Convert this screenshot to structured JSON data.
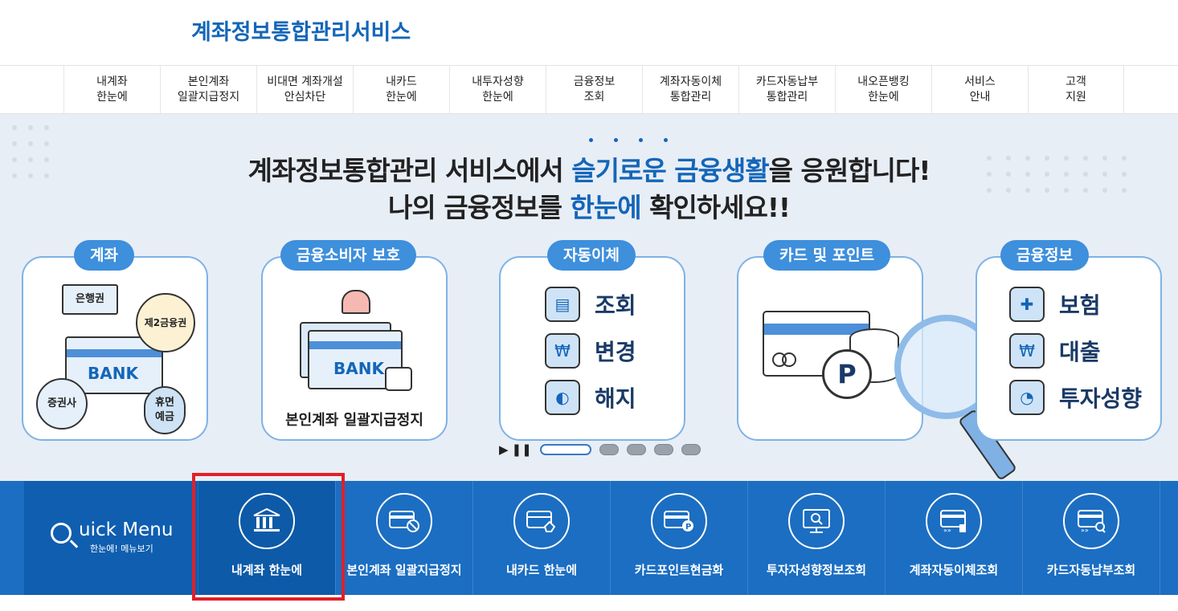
{
  "header": {
    "logo": "계좌정보통합관리서비스"
  },
  "gnb": [
    {
      "label": "내계좌\n한눈에"
    },
    {
      "label": "본인계좌\n일괄지급정지"
    },
    {
      "label": "비대면 계좌개설\n안심차단"
    },
    {
      "label": "내카드\n한눈에"
    },
    {
      "label": "내투자성향\n한눈에"
    },
    {
      "label": "금융정보\n조회"
    },
    {
      "label": "계좌자동이체\n통합관리"
    },
    {
      "label": "카드자동납부\n통합관리"
    },
    {
      "label": "내오픈뱅킹\n한눈에"
    },
    {
      "label": "서비스\n안내"
    },
    {
      "label": "고객\n지원"
    }
  ],
  "banner": {
    "line1_pre": "계좌정보통합관리 서비스에서 ",
    "line1_hl": "슬기로운 금융생활",
    "line1_post": "을 응원합니다!",
    "line2_pre": "나의 금융정보를 ",
    "line2_hl": "한눈에",
    "line2_post": " 확인하세요!!",
    "cards": [
      {
        "tag": "계좌",
        "bubbles": [
          "은행권",
          "제2금융권",
          "증권사",
          "휴면\n예금"
        ],
        "bank": "BANK"
      },
      {
        "tag": "금융소비자 보호",
        "bank": "BANK",
        "caption": "본인계좌 일괄지급정지"
      },
      {
        "tag": "자동이체",
        "items": [
          "조회",
          "변경",
          "해지"
        ]
      },
      {
        "tag": "카드 및 포인트",
        "point": "P"
      },
      {
        "tag": "금융정보",
        "items": [
          "보험",
          "대출",
          "투자성향"
        ]
      }
    ]
  },
  "quick": {
    "title_big": "uick Menu",
    "title_sub": "한눈에! 메뉴보기",
    "items": [
      {
        "label": "내계좌 한눈에",
        "icon": "bank-icon"
      },
      {
        "label": "본인계좌 일괄지급정지",
        "icon": "card-block-icon"
      },
      {
        "label": "내카드 한눈에",
        "icon": "card-hand-icon"
      },
      {
        "label": "카드포인트현금화",
        "icon": "card-point-icon"
      },
      {
        "label": "투자자성향정보조회",
        "icon": "monitor-search-icon"
      },
      {
        "label": "계좌자동이체조회",
        "icon": "auto-transfer-icon"
      },
      {
        "label": "카드자동납부조회",
        "icon": "card-search-icon"
      }
    ]
  }
}
